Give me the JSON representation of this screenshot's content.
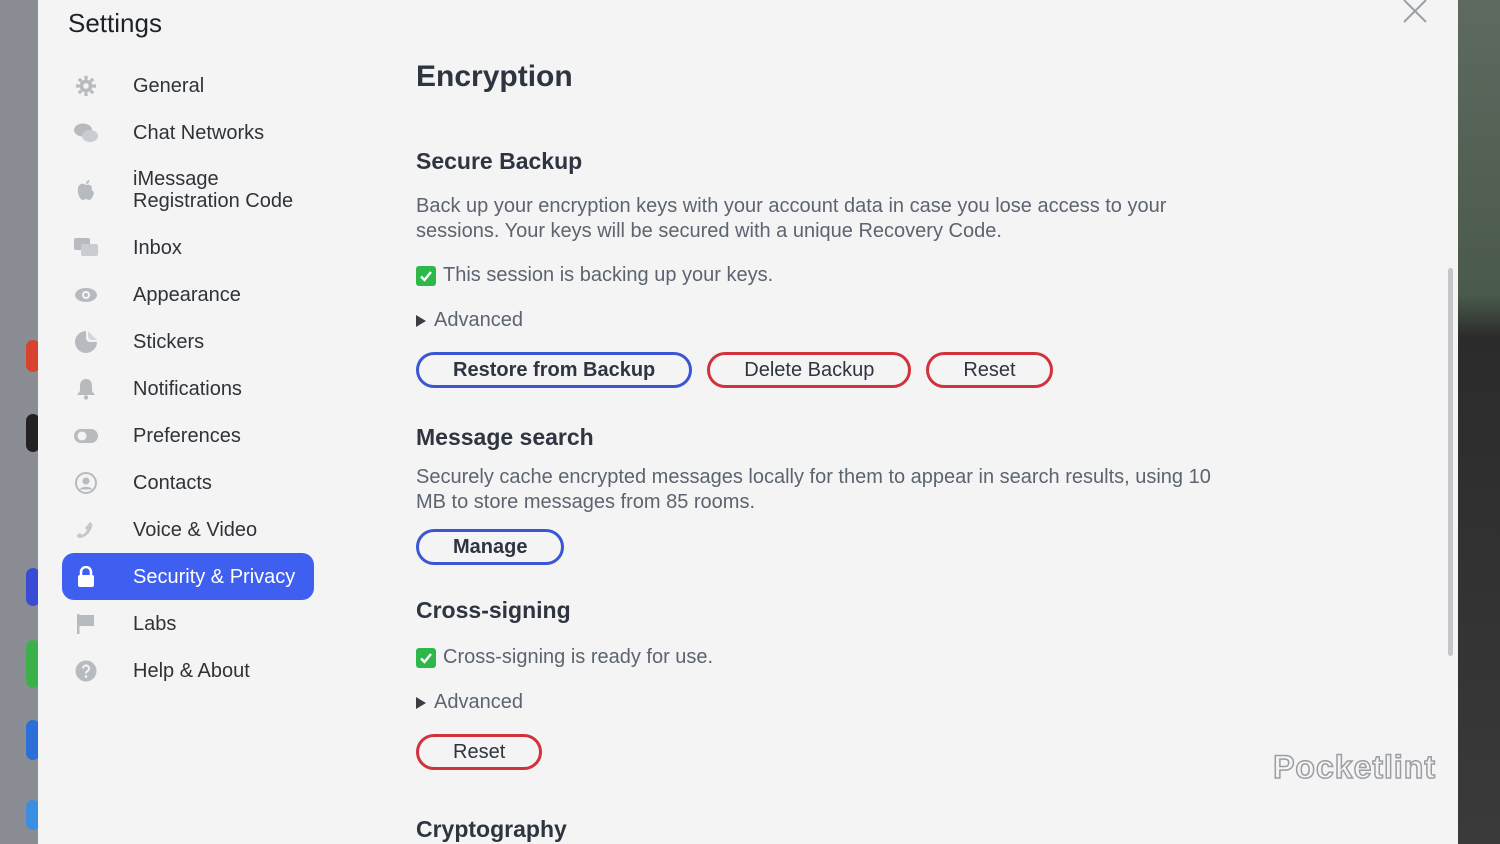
{
  "dialog": {
    "title": "Settings"
  },
  "sidebar": {
    "items": [
      {
        "label": "General",
        "icon": "gear-icon"
      },
      {
        "label": "Chat Networks",
        "icon": "chat-bubbles-icon"
      },
      {
        "label": "iMessage\nRegistration Code",
        "icon": "apple-icon"
      },
      {
        "label": "Inbox",
        "icon": "inbox-icon"
      },
      {
        "label": "Appearance",
        "icon": "eye-icon"
      },
      {
        "label": "Stickers",
        "icon": "sticker-icon"
      },
      {
        "label": "Notifications",
        "icon": "bell-icon"
      },
      {
        "label": "Preferences",
        "icon": "toggle-icon"
      },
      {
        "label": "Contacts",
        "icon": "contact-icon"
      },
      {
        "label": "Voice & Video",
        "icon": "phone-icon"
      },
      {
        "label": "Security & Privacy",
        "icon": "lock-icon",
        "active": true
      },
      {
        "label": "Labs",
        "icon": "flag-icon"
      },
      {
        "label": "Help & About",
        "icon": "help-icon"
      }
    ]
  },
  "main": {
    "title": "Encryption",
    "secure_backup": {
      "title": "Secure Backup",
      "description": "Back up your encryption keys with your account data in case you lose access to your sessions. Your keys will be secured with a unique Recovery Code.",
      "status": "This session is backing up your keys.",
      "advanced": "Advanced",
      "restore_button": "Restore from Backup",
      "delete_button": "Delete Backup",
      "reset_button": "Reset"
    },
    "message_search": {
      "title": "Message search",
      "description": "Securely cache encrypted messages locally for them to appear in search results, using 10 MB to store messages from 85 rooms.",
      "manage_button": "Manage"
    },
    "cross_signing": {
      "title": "Cross-signing",
      "status": "Cross-signing is ready for use.",
      "advanced": "Advanced",
      "reset_button": "Reset"
    },
    "cryptography": {
      "title": "Cryptography"
    }
  },
  "watermark": "Pocketlint",
  "colors": {
    "accent": "#3f5ff0",
    "primary_border": "#3a56d4",
    "danger_border": "#d2323c",
    "check_green": "#2eb84a"
  }
}
